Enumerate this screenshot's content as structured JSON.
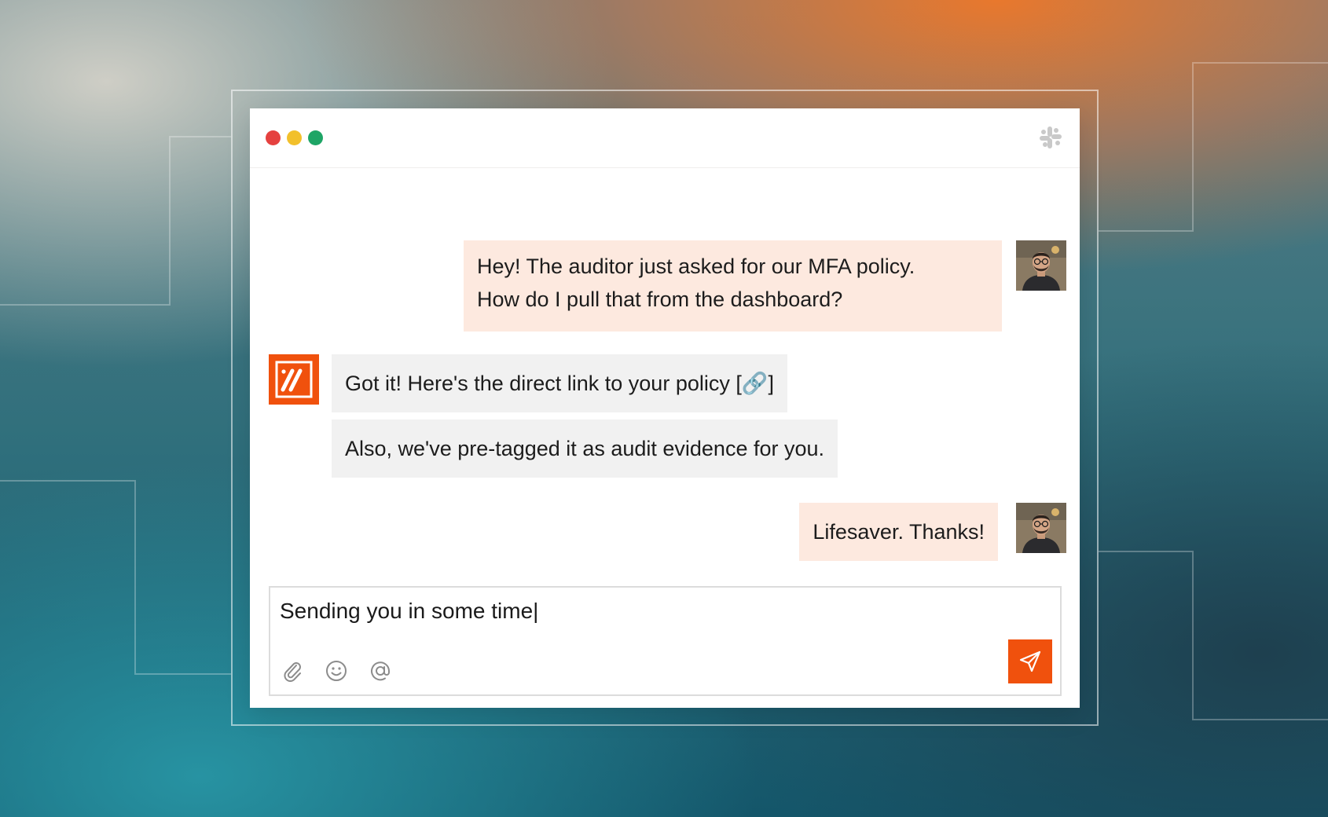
{
  "window": {
    "controls": [
      "close",
      "minimize",
      "maximize"
    ],
    "app_icon": "slack-icon"
  },
  "messages": [
    {
      "sender": "user",
      "lines": [
        "Hey! The auditor just asked for our MFA policy.",
        "How do I pull that from the dashboard?"
      ]
    },
    {
      "sender": "bot",
      "text": "Got it! Here's the direct link to your policy [🔗]"
    },
    {
      "sender": "bot",
      "text": "Also, we've pre-tagged it as audit evidence for you."
    },
    {
      "sender": "user",
      "text": "Lifesaver. Thanks!"
    }
  ],
  "composer": {
    "text": "Sending you in some time|",
    "tools": [
      "paperclip-icon",
      "emoji-icon",
      "at-sign-icon"
    ],
    "send_icon": "send-icon"
  },
  "colors": {
    "accent": "#f0510d",
    "user_bubble": "#fde9df",
    "bot_bubble": "#f1f1f1"
  }
}
